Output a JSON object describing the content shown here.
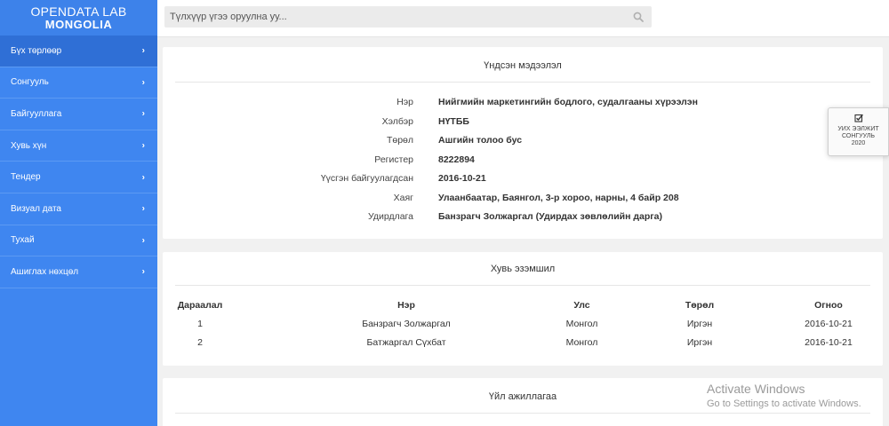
{
  "brand": {
    "line1": "OPENDATA LAB",
    "line2": "MONGOLIA"
  },
  "sidebar": {
    "items": [
      {
        "label": "Бүх төрлөөр",
        "active": true
      },
      {
        "label": "Сонгууль"
      },
      {
        "label": "Байгууллага"
      },
      {
        "label": "Хувь хүн"
      },
      {
        "label": "Тендер"
      },
      {
        "label": "Визуал дата"
      },
      {
        "label": "Тухай"
      },
      {
        "label": "Ашиглах нөхцөл"
      }
    ],
    "chevron": "›"
  },
  "search": {
    "placeholder": "Түлхүүр үгээ оруулна уу...",
    "value": ""
  },
  "basic_info": {
    "title": "Үндсэн мэдээлэл",
    "rows": [
      {
        "label": "Нэр",
        "value": "Нийгмийн маркетингийн бодлого, судалгааны хүрээлэн"
      },
      {
        "label": "Хэлбэр",
        "value": "НҮТББ"
      },
      {
        "label": "Төрөл",
        "value": "Ашгийн толоо бус"
      },
      {
        "label": "Регистер",
        "value": "8222894"
      },
      {
        "label": "Үүсгэн байгуулагдсан",
        "value": "2016-10-21"
      },
      {
        "label": "Хаяг",
        "value": "Улаанбаатар, Баянгол, 3-р хороо, нарны, 4 байр 208"
      },
      {
        "label": "Удирдлага",
        "value": "Банзрагч Золжаргал (Удирдах зөвлөлийн дарга)"
      }
    ]
  },
  "ownership": {
    "title": "Хувь эзэмшил",
    "headers": [
      "Дараалал",
      "Нэр",
      "Улс",
      "Төрөл",
      "Огноо"
    ],
    "rows": [
      [
        "1",
        "Банзрагч Золжаргал",
        "Монгол",
        "Иргэн",
        "2016-10-21"
      ],
      [
        "2",
        "Батжаргал Сүхбат",
        "Монгол",
        "Иргэн",
        "2016-10-21"
      ]
    ]
  },
  "activities": {
    "title": "Үйл ажиллагаа"
  },
  "widget": {
    "line1": "УИХ ЭЭЛЖИТ",
    "line2": "СОНГУУЛЬ",
    "line3": "2020",
    "icon": "checkbox-icon"
  },
  "watermark": {
    "line1": "Activate Windows",
    "line2": "Go to Settings to activate Windows."
  },
  "colors": {
    "sidebar": "#3f86f0",
    "sidebar_active": "#2f6fd6",
    "background": "#f1f1f1"
  }
}
